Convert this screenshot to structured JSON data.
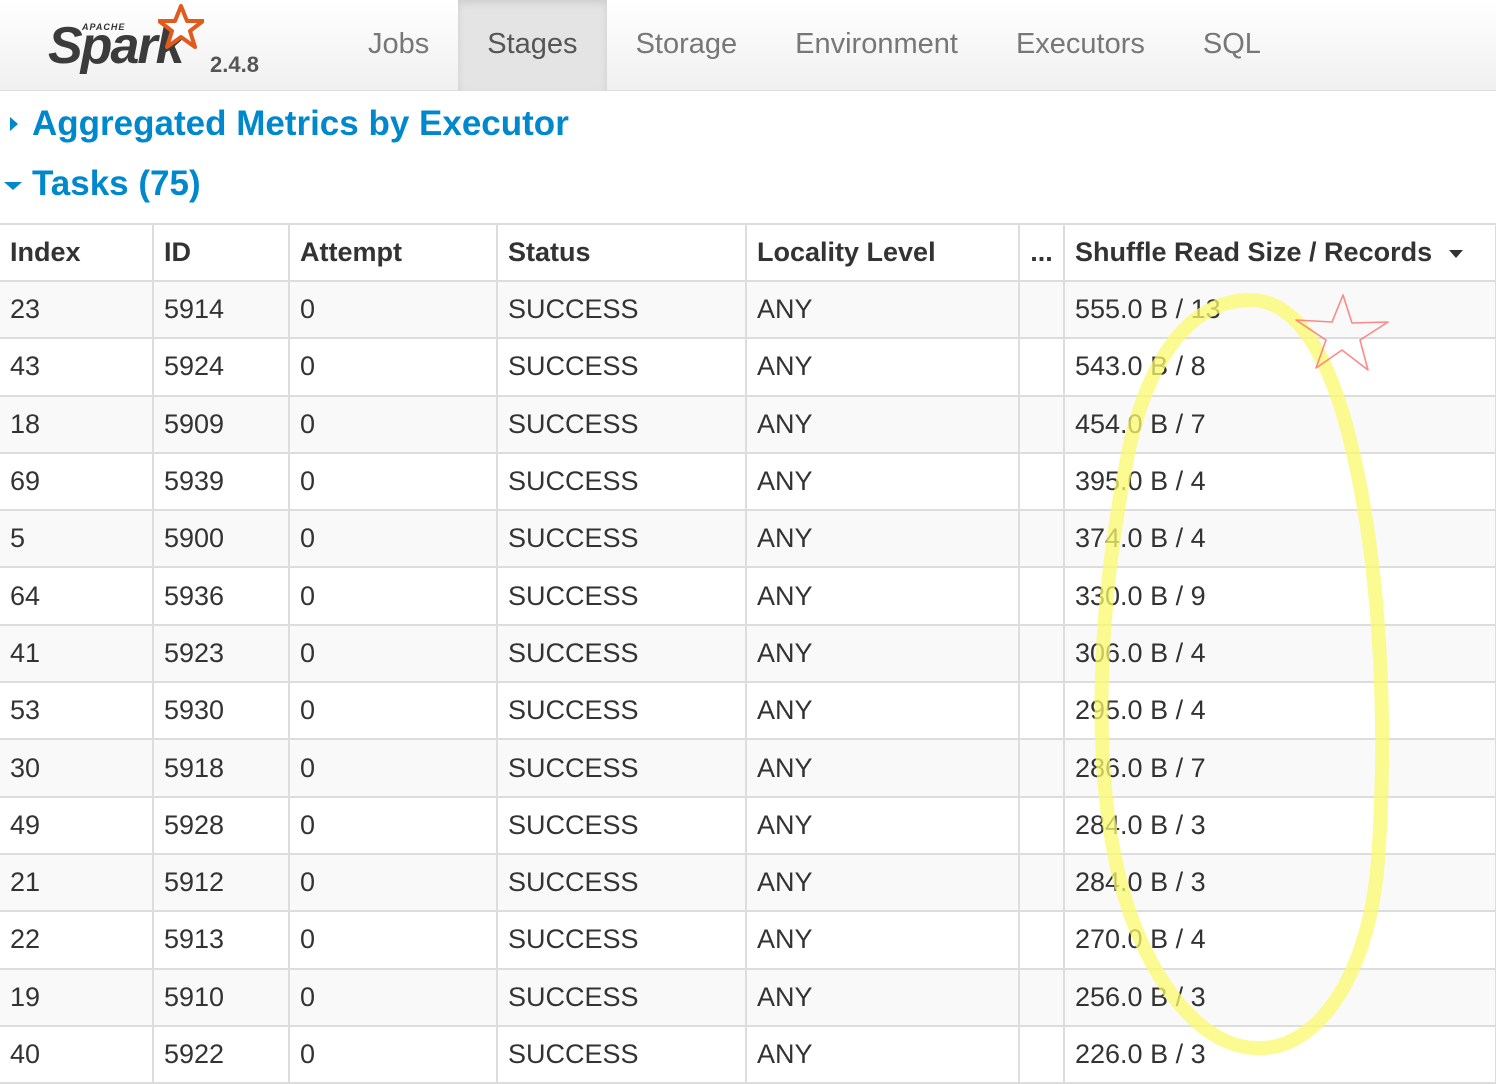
{
  "brand": {
    "apache": "APACHE",
    "name": "Spark",
    "version": "2.4.8"
  },
  "nav": {
    "tabs": [
      {
        "label": "Jobs",
        "active": false
      },
      {
        "label": "Stages",
        "active": true
      },
      {
        "label": "Storage",
        "active": false
      },
      {
        "label": "Environment",
        "active": false
      },
      {
        "label": "Executors",
        "active": false
      },
      {
        "label": "SQL",
        "active": false
      }
    ]
  },
  "sections": {
    "aggregated": {
      "title": "Aggregated Metrics by Executor",
      "expanded": false
    },
    "tasks": {
      "title": "Tasks (75)",
      "expanded": true
    }
  },
  "table": {
    "columns": [
      "Index",
      "ID",
      "Attempt",
      "Status",
      "Locality Level",
      "...",
      "Shuffle Read Size / Records"
    ],
    "sorted_column": "Shuffle Read Size / Records",
    "sort_direction": "descending",
    "rows": [
      [
        "23",
        "5914",
        "0",
        "SUCCESS",
        "ANY",
        "",
        "555.0 B / 13"
      ],
      [
        "43",
        "5924",
        "0",
        "SUCCESS",
        "ANY",
        "",
        "543.0 B / 8"
      ],
      [
        "18",
        "5909",
        "0",
        "SUCCESS",
        "ANY",
        "",
        "454.0 B / 7"
      ],
      [
        "69",
        "5939",
        "0",
        "SUCCESS",
        "ANY",
        "",
        "395.0 B / 4"
      ],
      [
        "5",
        "5900",
        "0",
        "SUCCESS",
        "ANY",
        "",
        "374.0 B / 4"
      ],
      [
        "64",
        "5936",
        "0",
        "SUCCESS",
        "ANY",
        "",
        "330.0 B / 9"
      ],
      [
        "41",
        "5923",
        "0",
        "SUCCESS",
        "ANY",
        "",
        "306.0 B / 4"
      ],
      [
        "53",
        "5930",
        "0",
        "SUCCESS",
        "ANY",
        "",
        "295.0 B / 4"
      ],
      [
        "30",
        "5918",
        "0",
        "SUCCESS",
        "ANY",
        "",
        "286.0 B / 7"
      ],
      [
        "49",
        "5928",
        "0",
        "SUCCESS",
        "ANY",
        "",
        "284.0 B / 3"
      ],
      [
        "21",
        "5912",
        "0",
        "SUCCESS",
        "ANY",
        "",
        "284.0 B / 3"
      ],
      [
        "22",
        "5913",
        "0",
        "SUCCESS",
        "ANY",
        "",
        "270.0 B / 4"
      ],
      [
        "19",
        "5910",
        "0",
        "SUCCESS",
        "ANY",
        "",
        "256.0 B / 3"
      ],
      [
        "40",
        "5922",
        "0",
        "SUCCESS",
        "ANY",
        "",
        "226.0 B / 3"
      ]
    ]
  },
  "annotations": {
    "highlight_color": "#fafa6e",
    "star_color": "#ff6b6b"
  },
  "colors": {
    "link": "#0088cc",
    "navbar_bg": "#f5f5f5",
    "active_tab_bg": "#e4e4e4",
    "grid_line": "#dddddd",
    "stripe": "#f9f9f9"
  }
}
